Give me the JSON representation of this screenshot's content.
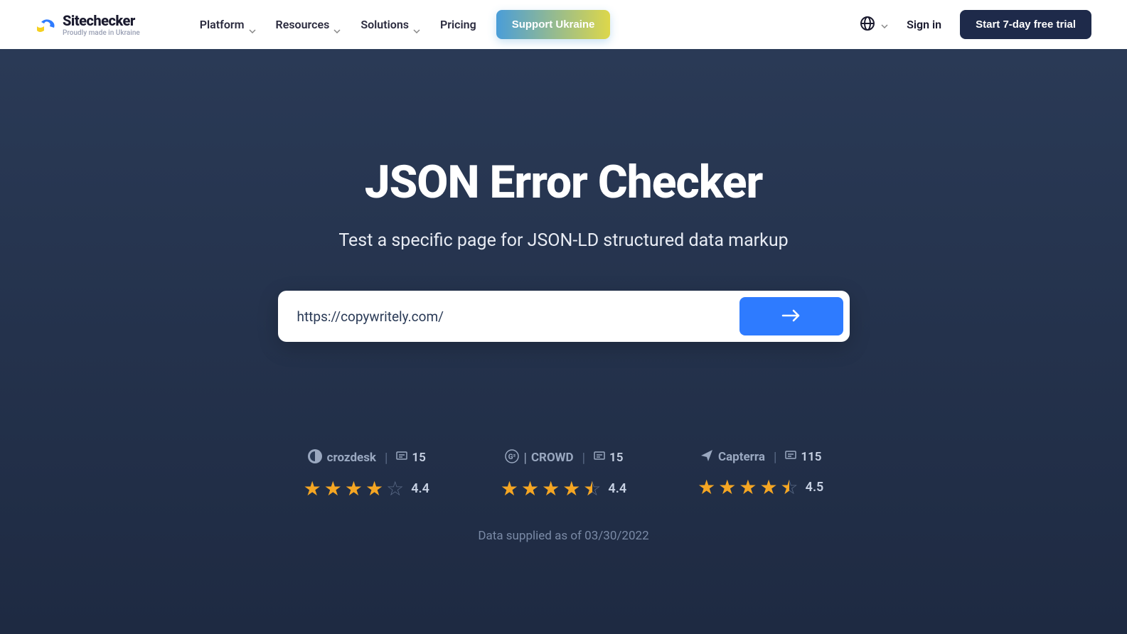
{
  "header": {
    "logo": {
      "title": "Sitechecker",
      "subtitle": "Proudly made in Ukraine"
    },
    "nav": {
      "platform": "Platform",
      "resources": "Resources",
      "solutions": "Solutions",
      "pricing": "Pricing"
    },
    "support_btn": "Support Ukraine",
    "sign_in": "Sign in",
    "trial_btn": "Start 7-day free trial"
  },
  "hero": {
    "title": "JSON Error Checker",
    "subtitle": "Test a specific page for JSON-LD structured data markup",
    "input_value": "https://copywritely.com/"
  },
  "reviews": {
    "crozdesk": {
      "name": "crozdesk",
      "count": "15",
      "rating": "4.4"
    },
    "g2crowd": {
      "name": "CROWD",
      "count": "15",
      "rating": "4.4"
    },
    "capterra": {
      "name": "Capterra",
      "count": "115",
      "rating": "4.5"
    },
    "data_date": "Data supplied as of 03/30/2022"
  }
}
